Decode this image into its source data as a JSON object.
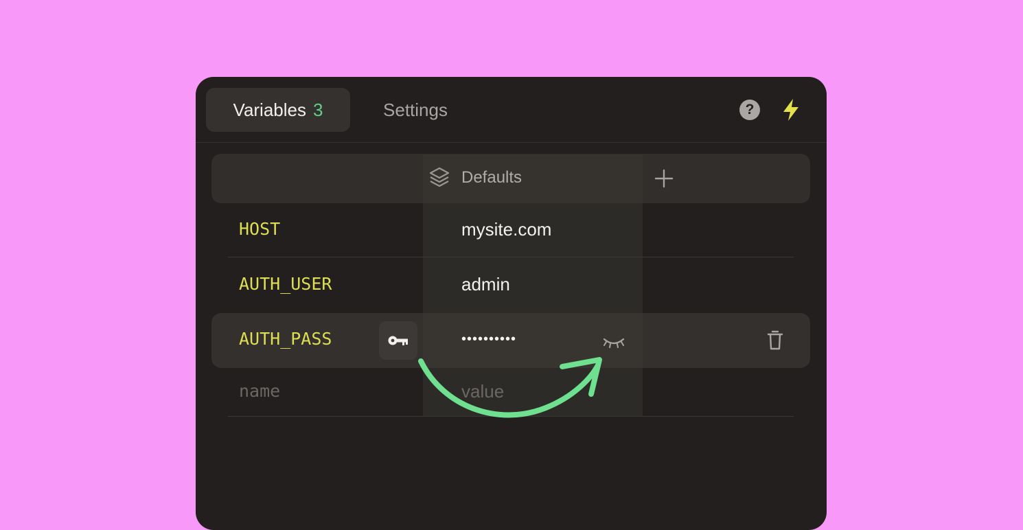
{
  "tabs": {
    "variables_label": "Variables",
    "variables_count": "3",
    "settings_label": "Settings"
  },
  "topbar_icons": [
    "help-icon",
    "bolt-icon"
  ],
  "column": {
    "header_label": "Defaults",
    "header_icon": "layers-icon",
    "add_icon": "plus-icon"
  },
  "variables": [
    {
      "name": "HOST",
      "value": "mysite.com"
    },
    {
      "name": "AUTH_USER",
      "value": "admin"
    },
    {
      "name": "AUTH_PASS",
      "value": "••••••••••",
      "secret": true
    }
  ],
  "new_row": {
    "name_placeholder": "name",
    "value_placeholder": "value"
  },
  "colors": {
    "background": "#f898f8",
    "panel": "#221f1e",
    "accent_green": "#5fd08a",
    "variable_name": "#dede52",
    "bolt": "#e2e24a"
  }
}
